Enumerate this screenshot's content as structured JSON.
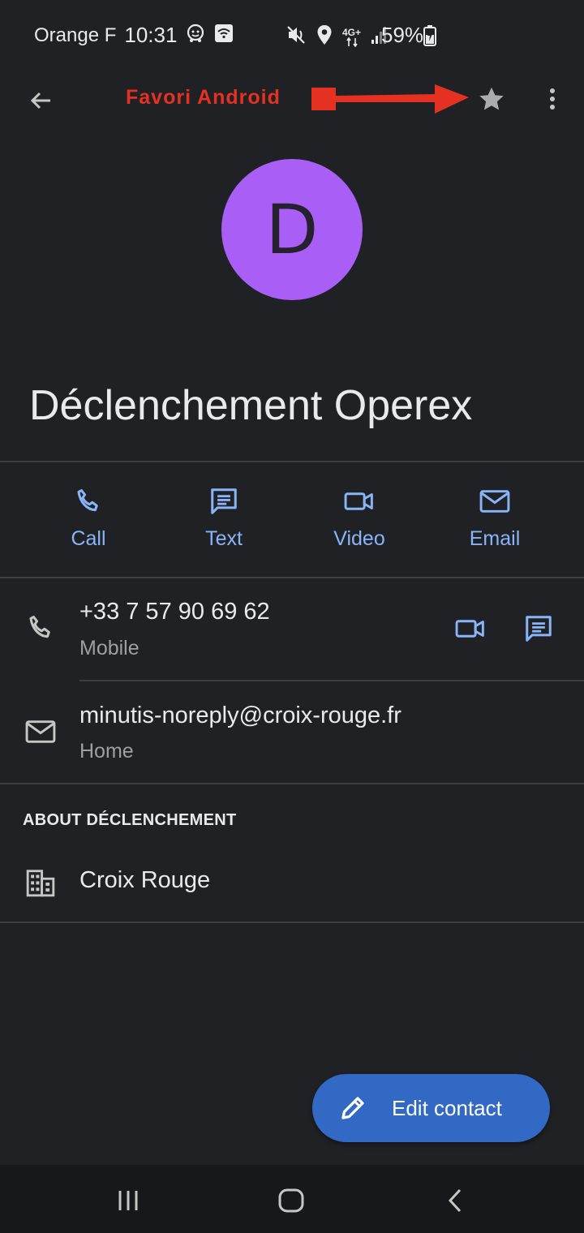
{
  "status_bar": {
    "carrier": "Orange F",
    "time": "10:31",
    "network": "4G+",
    "battery_percent": "59%"
  },
  "app_bar": {
    "annotation_label": "Favori Android",
    "annotation_color": "#e53122"
  },
  "contact": {
    "avatar_letter": "D",
    "avatar_color": "#a95ef5",
    "name": "Déclenchement Operex"
  },
  "actions": [
    {
      "label": "Call",
      "icon": "phone-icon"
    },
    {
      "label": "Text",
      "icon": "message-icon"
    },
    {
      "label": "Video",
      "icon": "videocam-icon"
    },
    {
      "label": "Email",
      "icon": "mail-icon"
    }
  ],
  "phone": {
    "number": "+33 7 57 90 69 62",
    "type": "Mobile"
  },
  "email": {
    "address": "minutis-noreply@croix-rouge.fr",
    "type": "Home"
  },
  "about": {
    "header": "ABOUT DÉCLENCHEMENT",
    "company": "Croix Rouge"
  },
  "fab": {
    "label": "Edit contact",
    "color": "#3269c4"
  },
  "colors": {
    "background": "#202124",
    "accent": "#8ab4f8"
  }
}
